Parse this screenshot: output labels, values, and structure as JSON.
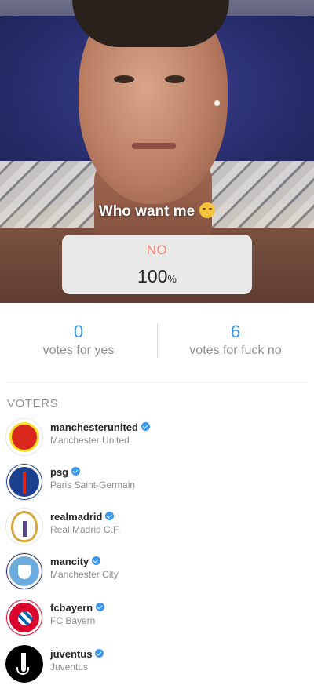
{
  "poll": {
    "question": "Who want me",
    "question_emoji": "smirking-face-emoji",
    "option": "NO",
    "percent_value": "100",
    "percent_sign": "%"
  },
  "stats": {
    "yes_count": "0",
    "yes_label": "votes for yes",
    "no_count": "6",
    "no_label": "votes for fuck no"
  },
  "voters_title": "VOTERS",
  "voters": [
    {
      "username": "manchesterunited",
      "fullname": "Manchester United",
      "avatar_icon": "manchester-united-crest-icon"
    },
    {
      "username": "psg",
      "fullname": "Paris Saint-Germain",
      "avatar_icon": "psg-crest-icon"
    },
    {
      "username": "realmadrid",
      "fullname": "Real Madrid C.F.",
      "avatar_icon": "real-madrid-crest-icon"
    },
    {
      "username": "mancity",
      "fullname": "Manchester City",
      "avatar_icon": "manchester-city-crest-icon"
    },
    {
      "username": "fcbayern",
      "fullname": "FC Bayern",
      "avatar_icon": "fc-bayern-crest-icon"
    },
    {
      "username": "juventus",
      "fullname": "Juventus",
      "avatar_icon": "juventus-crest-icon"
    }
  ],
  "colors": {
    "accent_blue": "#3897f0",
    "option_red": "#f2816f",
    "muted_gray": "#8e8e8e"
  }
}
